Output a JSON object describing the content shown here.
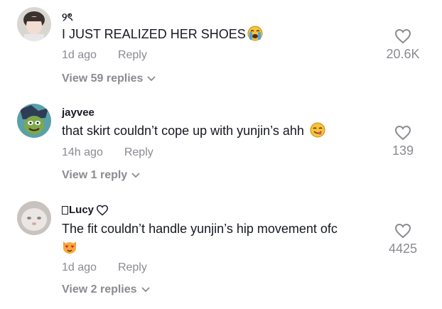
{
  "comments": [
    {
      "username": "୨ৎ",
      "text": "I JUST REALIZED HER SHOES",
      "emoji": "loudly-crying-face",
      "time": "1d ago",
      "reply_label": "Reply",
      "likes": "20.6K",
      "view_replies": "View 59 replies"
    },
    {
      "username": "jayvee",
      "text": "that skirt couldn’t cope up with yunjin’s ahh",
      "emoji": "face-savoring-food",
      "time": "14h ago",
      "reply_label": "Reply",
      "likes": "139",
      "view_replies": "View 1 reply"
    },
    {
      "username": "Lucy",
      "text": "The fit couldn’t handle yunjin’s hip movement ofc",
      "emoji": "heart-eyes-cat",
      "time": "1d ago",
      "reply_label": "Reply",
      "likes": "4425",
      "view_replies": "View 2 replies"
    }
  ]
}
